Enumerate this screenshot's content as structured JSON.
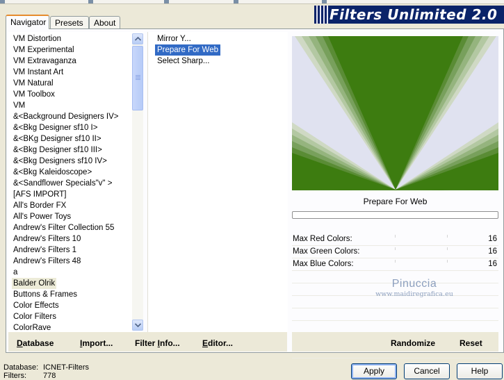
{
  "app": {
    "banner_title": "Filters Unlimited 2.0"
  },
  "tabs": [
    "Navigator",
    "Presets",
    "About"
  ],
  "categories": [
    "VM Distortion",
    "VM Experimental",
    "VM Extravaganza",
    "VM Instant Art",
    "VM Natural",
    "VM Toolbox",
    "VM",
    "&<Background Designers IV>",
    "&<Bkg Designer sf10 I>",
    "&<BKg Designer sf10 II>",
    "&<Bkg Designer sf10 III>",
    "&<Bkg Designers sf10 IV>",
    "&<Bkg Kaleidoscope>",
    "&<Sandflower Specials\"v\" >",
    "[AFS IMPORT]",
    "All's Border FX",
    "All's Power Toys",
    "Andrew's Filter Collection 55",
    "Andrew's Filters 10",
    "Andrew's Filters 1",
    "Andrew's Filters 48",
    "a",
    "Balder Olrik",
    "Buttons & Frames",
    "Color Effects",
    "Color Filters",
    "ColorRave"
  ],
  "selected_category": "Balder Olrik",
  "filters": [
    "Mirror Y...",
    "Prepare For Web",
    "Select Sharp..."
  ],
  "selected_filter": "Prepare For Web",
  "preview": {
    "colors": {
      "green": "#3d7c10",
      "bg": "#e0e2f0"
    }
  },
  "filter_name": "Prepare For Web",
  "params": [
    {
      "label": "Max Red Colors:",
      "value": "16"
    },
    {
      "label": "Max Green Colors:",
      "value": "16"
    },
    {
      "label": "Max Blue Colors:",
      "value": "16"
    }
  ],
  "watermark": {
    "line1": "Pinuccia",
    "line2": "www.maidiregrafica.eu"
  },
  "bottom_bar": {
    "database": {
      "u": "D",
      "rest": "atabase"
    },
    "import": {
      "u": "I",
      "rest": "mport..."
    },
    "filter_info": {
      "pre": "Filter ",
      "u": "I",
      "post": "nfo..."
    },
    "editor": {
      "u": "E",
      "rest": "ditor..."
    },
    "randomize": "Randomize",
    "reset": "Reset"
  },
  "info": {
    "db_label": "Database:",
    "db_value": "ICNET-Filters",
    "filters_label": "Filters:",
    "filters_value": "778"
  },
  "dialog_buttons": {
    "apply": "Apply",
    "cancel": "Cancel",
    "help": "Help"
  }
}
